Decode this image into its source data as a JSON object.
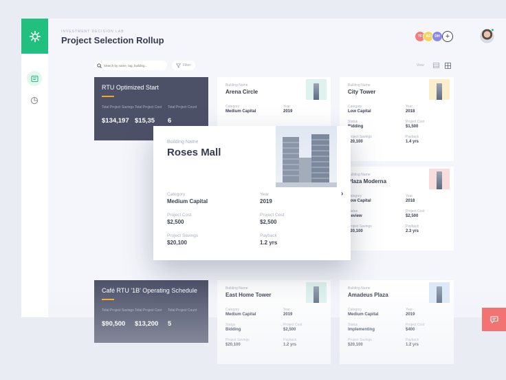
{
  "header": {
    "kicker": "INVESTMENT DECISION LAB",
    "title": "Project Selection Rollup"
  },
  "avatars": [
    {
      "initials": "TF",
      "color": "#f47c7c"
    },
    {
      "initials": "AS",
      "color": "#f8d35e"
    },
    {
      "initials": "DH",
      "color": "#8c88e6"
    }
  ],
  "toolbar": {
    "search_placeholder": "Search by name, tag, building...",
    "filter_label": "Filter",
    "view_label": "View"
  },
  "groups": [
    {
      "title": "RTU Optimized Start",
      "stats": [
        {
          "label": "Total Project Savings",
          "value": "$134,197"
        },
        {
          "label": "Total Project Cost",
          "value": "$15,35"
        },
        {
          "label": "Total Project Count",
          "value": "6"
        }
      ]
    },
    {
      "title": "Café RTU '1B' Operating Schedule",
      "stats": [
        {
          "label": "Total Project Savings",
          "value": "$90,500"
        },
        {
          "label": "Total Project Cost",
          "value": "$13,200"
        },
        {
          "label": "Total Project Count",
          "value": "5"
        }
      ]
    }
  ],
  "labels": {
    "building_name": "Building Name",
    "category": "Category",
    "year": "Year",
    "status": "Status",
    "project_cost": "Project Cost",
    "project_savings": "Project Savings",
    "payback": "Payback"
  },
  "cards": [
    {
      "name": "Arena Circle",
      "category": "Medium Capital",
      "year": "2019",
      "thumb_bg": "#dff3ee"
    },
    {
      "name": "City Tower",
      "category": "Low Capital",
      "year": "2018",
      "status": "Bidding",
      "cost": "$1,500",
      "savings": "$20,100",
      "payback": "1.4 yrs",
      "thumb_bg": "#fbeecb"
    },
    {
      "name": "Plaza Moderna",
      "category": "Low Capital",
      "year": "2018",
      "status": "Review",
      "cost": "$2,500",
      "savings": "$20,100",
      "payback": "2.3 yrs",
      "thumb_bg": "#f9dcdc"
    },
    {
      "name": "East Home Tower",
      "category": "Medium Capital",
      "year": "2019",
      "status": "Bidding",
      "cost": "$2,500",
      "savings": "$20,100",
      "payback": "1.2 yrs",
      "thumb_bg": "#dff3ee"
    },
    {
      "name": "Amadeus Plaza",
      "category": "Medium Capital",
      "year": "2019",
      "status": "Implementing",
      "cost": "$400",
      "savings": "$20,100",
      "payback": "1.2 yrs",
      "thumb_bg": "#dde9f7"
    }
  ],
  "modal": {
    "name": "Roses Mall",
    "category": "Medium Capital",
    "year": "2019",
    "cost": "$2,500",
    "cost_right": "$2,500",
    "savings": "$20,100",
    "payback": "1.2 yrs"
  },
  "colors": {
    "accent": "#21c07f",
    "dark_card": "#4d5168",
    "chat": "#f37373",
    "highlight": "#f5a623"
  }
}
